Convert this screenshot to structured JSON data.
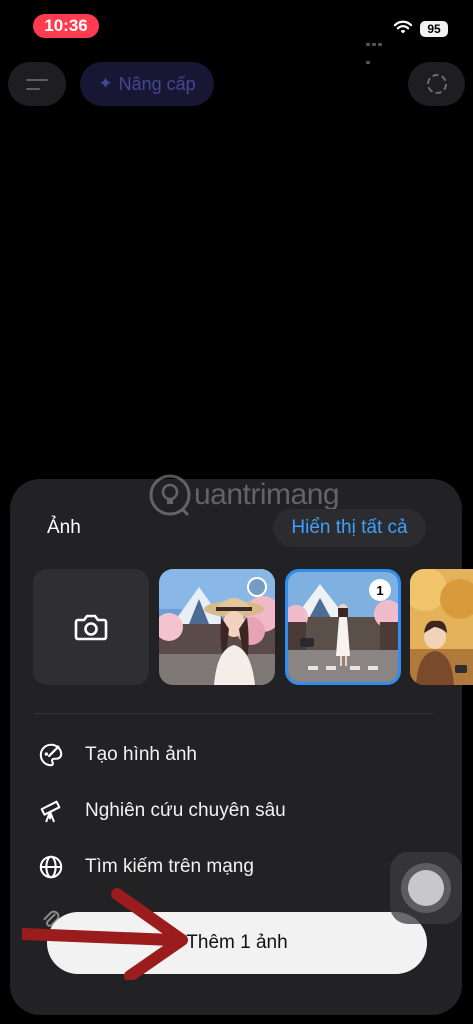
{
  "status_bar": {
    "time": "10:36",
    "battery": "95",
    "icons": [
      "cellular-dots-icon",
      "wifi-icon",
      "battery-icon"
    ]
  },
  "header": {
    "menu_icon": "menu-icon",
    "upgrade_label": "Nâng cấp",
    "upgrade_icon": "sparkle-icon",
    "temporary_chat_icon": "dashed-circle-icon"
  },
  "watermark": {
    "text": "uantrimang"
  },
  "sheet": {
    "title": "Ảnh",
    "show_all_label": "Hiển thị tất cả",
    "camera_icon": "camera-icon",
    "photos": [
      {
        "name": "photo-woman-hat-mount-fuji",
        "selected": false
      },
      {
        "name": "photo-woman-white-dress-street",
        "selected": true,
        "badge": "1"
      },
      {
        "name": "photo-man-autumn-park",
        "selected": false
      }
    ],
    "menu": [
      {
        "label": "Tạo hình ảnh",
        "icon": "palette-icon"
      },
      {
        "label": "Nghiên cứu chuyên sâu",
        "icon": "telescope-icon"
      },
      {
        "label": "Tìm kiếm trên mạng",
        "icon": "globe-icon"
      },
      {
        "label": "",
        "icon": "paperclip-icon"
      }
    ],
    "add_button_label": "Thêm 1 ảnh"
  },
  "colors": {
    "status_time_bg": "#ff3b4f",
    "accent_blue": "#3e9ffa",
    "sheet_bg": "#222224",
    "arrow_red": "#9b1c1c"
  }
}
